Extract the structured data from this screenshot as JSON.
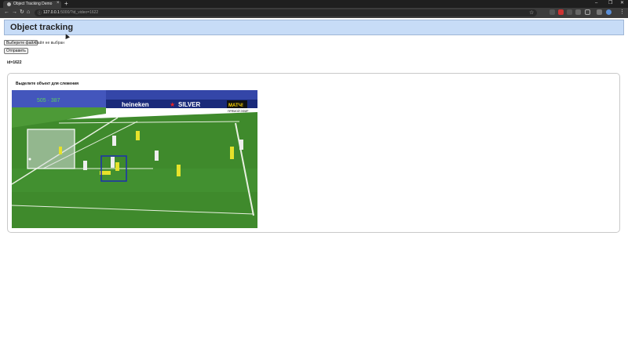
{
  "browser": {
    "tab_title": "Object Tracking Demo",
    "new_tab": "+",
    "url_host": "127.0.0.1",
    "url_path": ":5000/?id_video=1622",
    "window_controls": [
      "–",
      "❐",
      "✕"
    ]
  },
  "page": {
    "title": "Object tracking",
    "file_button": "Выберите файл",
    "file_status": "Файл не выбран",
    "submit_button": "Отправить",
    "id_label": "id=1622",
    "panel_title": "Выделите объект для слежения",
    "video_overlay": {
      "score_text": "505 · 387",
      "broadcaster": "МАТЧ!",
      "broadcaster_sub": "ПРЯМОЙ ЭФИР",
      "ad_text": "SILVER"
    }
  },
  "colors": {
    "header_bg": "#c7dcf7",
    "pitch": "#3f8a2c",
    "tracking_box": "#1b2fb0",
    "team_yellow": "#e6e22b"
  }
}
